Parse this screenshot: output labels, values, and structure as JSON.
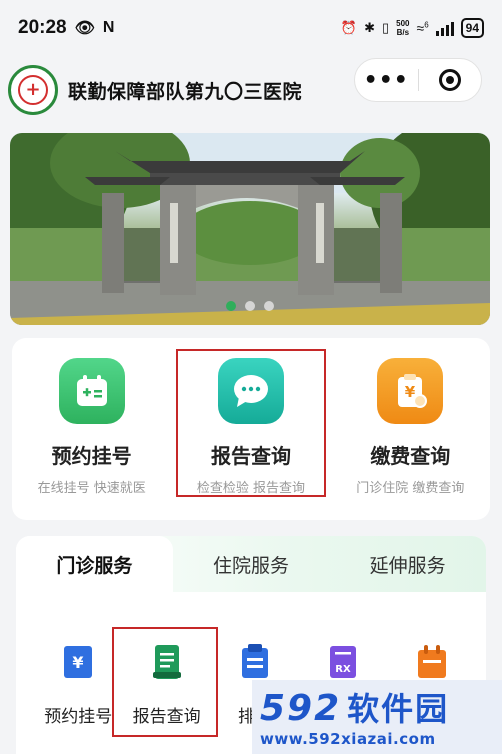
{
  "status_bar": {
    "time": "20:28",
    "net_speed_value": "500",
    "net_speed_unit": "B/s",
    "wifi_label": "6",
    "battery": "94"
  },
  "header": {
    "hospital_name": "联勤保障部队第九〇三医院",
    "more_label": "•••"
  },
  "banner": {
    "slide_count": 3,
    "active_slide": 1
  },
  "features": [
    {
      "title": "预约挂号",
      "subtitle": "在线挂号 快速就医",
      "color": "#3cc56e",
      "icon": "calendar-icon"
    },
    {
      "title": "报告查询",
      "subtitle": "检查检验 报告查询",
      "color": "#20bfa9",
      "icon": "chat-bubble-icon"
    },
    {
      "title": "缴费查询",
      "subtitle": "门诊住院 缴费查询",
      "color": "#f39a1e",
      "icon": "yen-clipboard-icon"
    }
  ],
  "tabs": [
    {
      "label": "门诊服务",
      "active": true
    },
    {
      "label": "住院服务",
      "active": false
    },
    {
      "label": "延伸服务",
      "active": false
    }
  ],
  "services": [
    {
      "label": "预约挂号",
      "icon": "yen-ticket-icon",
      "color": "#2f6fe0"
    },
    {
      "label": "报告查询",
      "icon": "report-icon",
      "color": "#1f9a5a"
    },
    {
      "label": "排队",
      "icon": "queue-icon",
      "color": "#2f6fe0"
    },
    {
      "label": "",
      "icon": "rx-icon",
      "color": "#7b4fe0"
    },
    {
      "label": "",
      "icon": "calendar-orange-icon",
      "color": "#f07a1e"
    }
  ],
  "watermark": {
    "number": "592",
    "name": "软件园",
    "url": "www.592xiazai.com"
  }
}
